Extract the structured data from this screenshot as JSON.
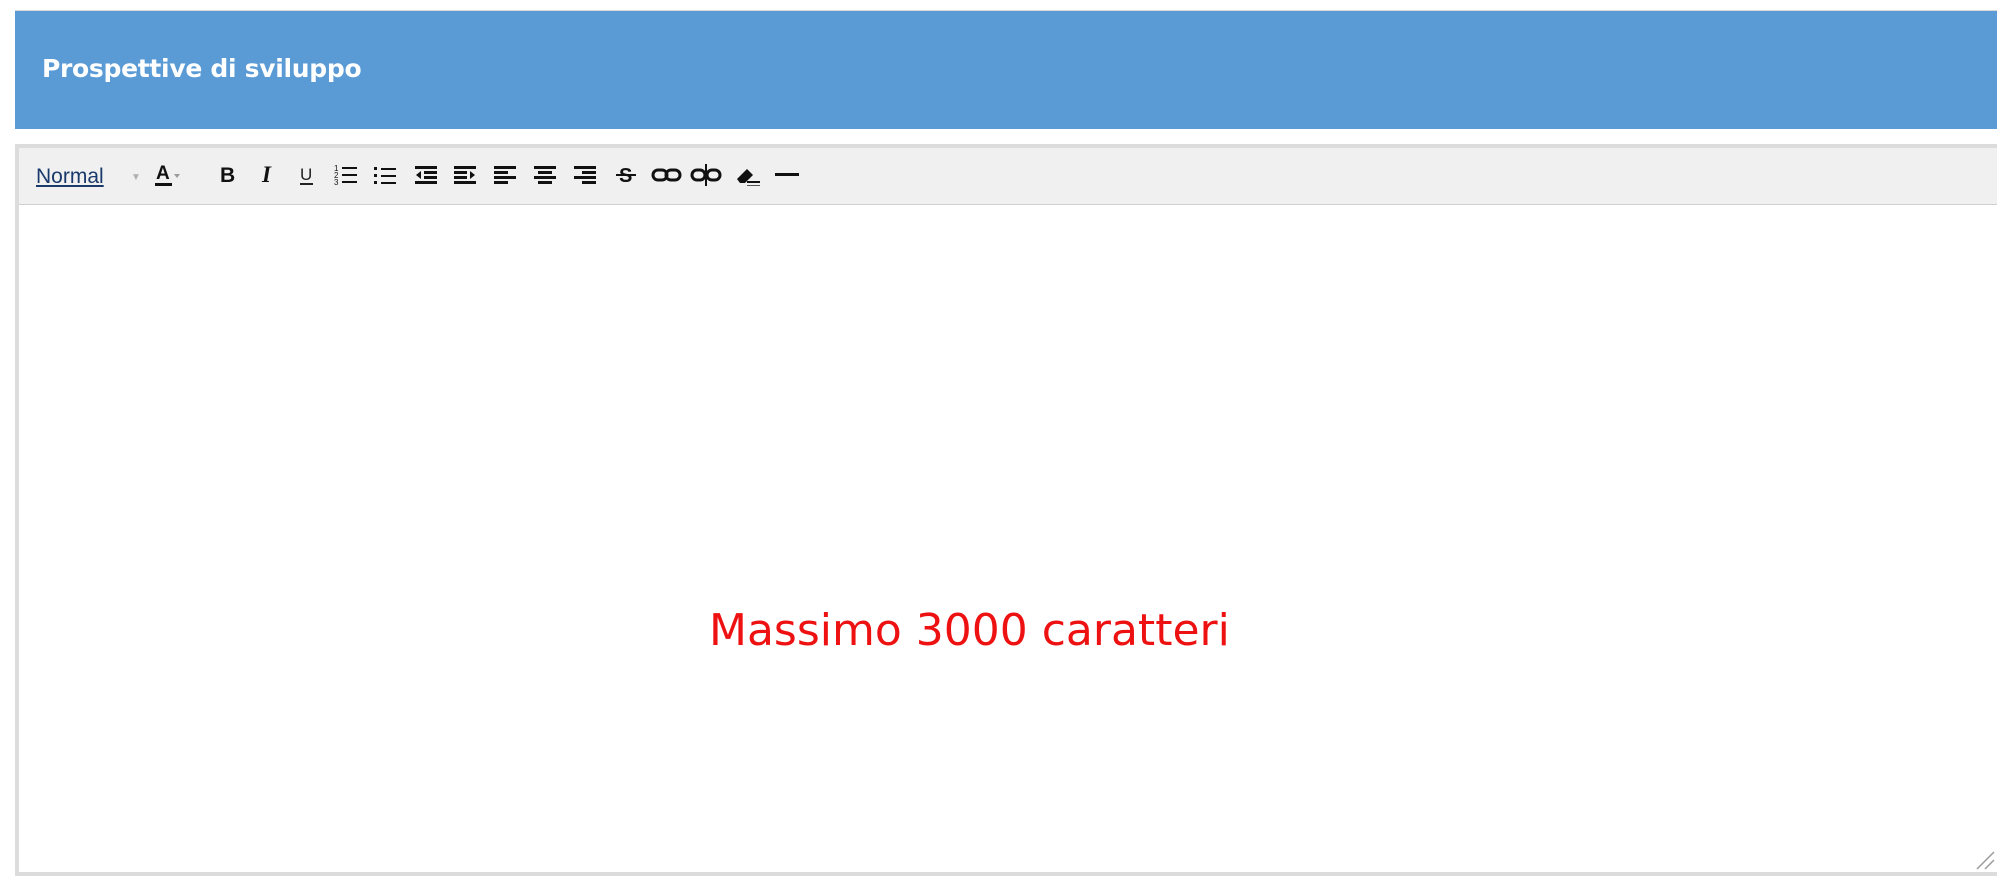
{
  "panel": {
    "title": "Prospettive di sviluppo"
  },
  "toolbar": {
    "format_label": "Normal",
    "format_caret_icon": "dropdown-caret-icon",
    "buttons": [
      {
        "name": "font-color-button",
        "icon": "font-color-icon"
      },
      {
        "name": "bold-button",
        "icon": "bold-icon",
        "label": "B"
      },
      {
        "name": "italic-button",
        "icon": "italic-icon",
        "label": "I"
      },
      {
        "name": "underline-button",
        "icon": "underline-icon",
        "label": "U"
      },
      {
        "name": "ordered-list-button",
        "icon": "ordered-list-icon"
      },
      {
        "name": "bullet-list-button",
        "icon": "bullet-list-icon"
      },
      {
        "name": "outdent-button",
        "icon": "outdent-icon"
      },
      {
        "name": "indent-button",
        "icon": "indent-icon"
      },
      {
        "name": "align-left-button",
        "icon": "align-left-icon"
      },
      {
        "name": "align-center-button",
        "icon": "align-center-icon"
      },
      {
        "name": "align-right-button",
        "icon": "align-right-icon"
      },
      {
        "name": "strikethrough-button",
        "icon": "strikethrough-icon",
        "label": "S"
      },
      {
        "name": "link-button",
        "icon": "link-icon"
      },
      {
        "name": "unlink-button",
        "icon": "unlink-icon"
      },
      {
        "name": "clear-format-button",
        "icon": "eraser-icon"
      },
      {
        "name": "horizontal-rule-button",
        "icon": "horizontal-rule-icon"
      }
    ]
  },
  "editor": {
    "note": "Massimo 3000 caratteri"
  },
  "colors": {
    "header_bg": "#5b9bd5",
    "header_text": "#ffffff",
    "toolbar_bg": "#f0f0f0",
    "note_color": "#ee1111"
  }
}
